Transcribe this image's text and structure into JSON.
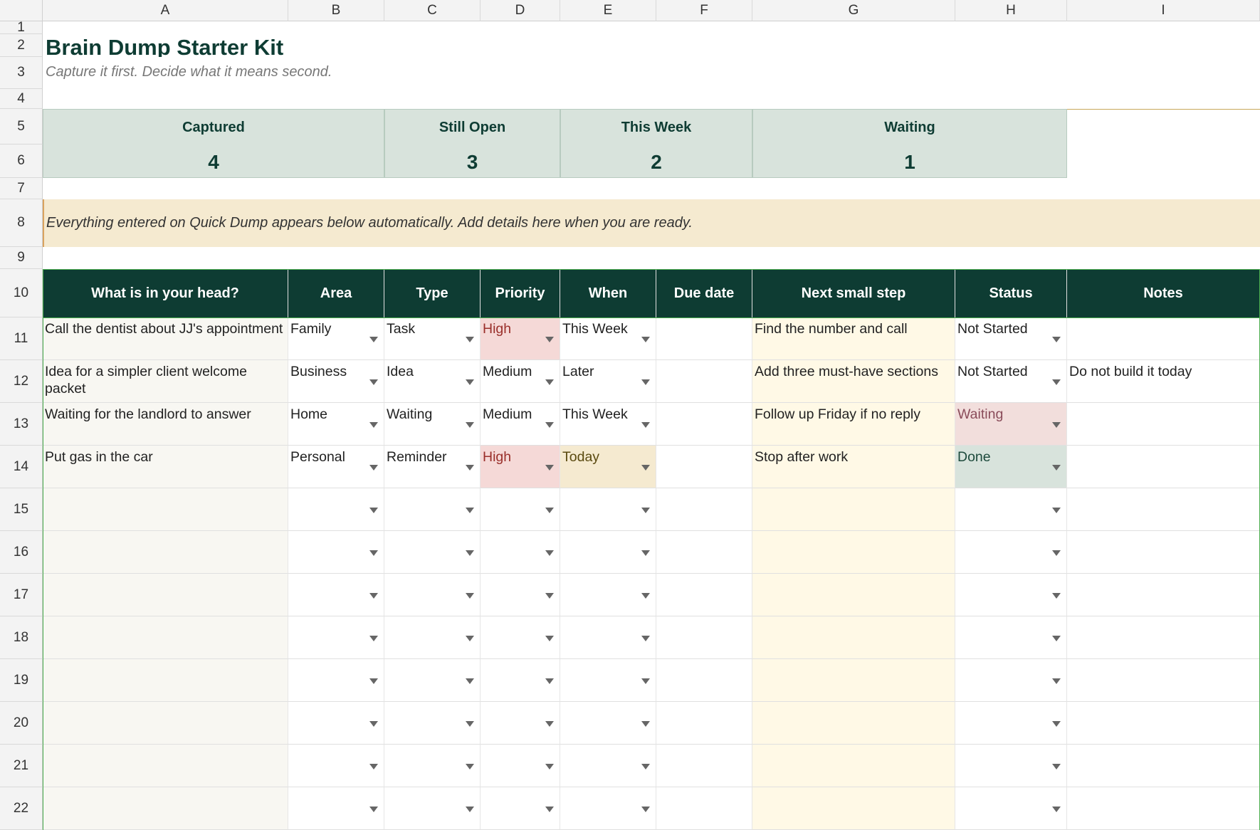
{
  "columns": [
    "A",
    "B",
    "C",
    "D",
    "E",
    "F",
    "G",
    "H",
    "I"
  ],
  "rows": [
    "1",
    "2",
    "3",
    "4",
    "5",
    "6",
    "7",
    "8",
    "9",
    "10",
    "11",
    "12",
    "13",
    "14",
    "15",
    "16",
    "17",
    "18",
    "19",
    "20",
    "21",
    "22"
  ],
  "title": "Brain Dump Starter Kit",
  "subtitle": "Capture it first. Decide what it means second.",
  "summary": [
    {
      "label": "Captured",
      "value": "4"
    },
    {
      "label": "Still Open",
      "value": "3"
    },
    {
      "label": "This Week",
      "value": "2"
    },
    {
      "label": "Waiting",
      "value": "1"
    }
  ],
  "note": "Everything entered on Quick Dump appears below automatically. Add details here when you are ready.",
  "table": {
    "headers": [
      "What is in your head?",
      "Area",
      "Type",
      "Priority",
      "When",
      "Due date",
      "Next small step",
      "Status",
      "Notes"
    ],
    "rows": [
      [
        "Call the dentist about JJ's appointment",
        "Family",
        "Task",
        "High",
        "This Week",
        "",
        "Find the number and call",
        "Not Started",
        ""
      ],
      [
        "Idea for a simpler client welcome packet",
        "Business",
        "Idea",
        "Medium",
        "Later",
        "",
        "Add three must-have sections",
        "Not Started",
        "Do not build it today"
      ],
      [
        "Waiting for the landlord to answer",
        "Home",
        "Waiting",
        "Medium",
        "This Week",
        "",
        "Follow up Friday if no reply",
        "Waiting",
        ""
      ],
      [
        "Put gas in the car",
        "Personal",
        "Reminder",
        "High",
        "Today",
        "",
        "Stop after work",
        "Done",
        ""
      ]
    ]
  },
  "colors": {
    "header_bg": "#0e3c33",
    "card_bg": "#d8e3dc",
    "note_bg": "#f5ead0",
    "high_bg": "#f5d9d7",
    "next_step_bg": "#fff9e6"
  },
  "icons": {
    "dropdown": "dropdown-arrow-icon"
  }
}
